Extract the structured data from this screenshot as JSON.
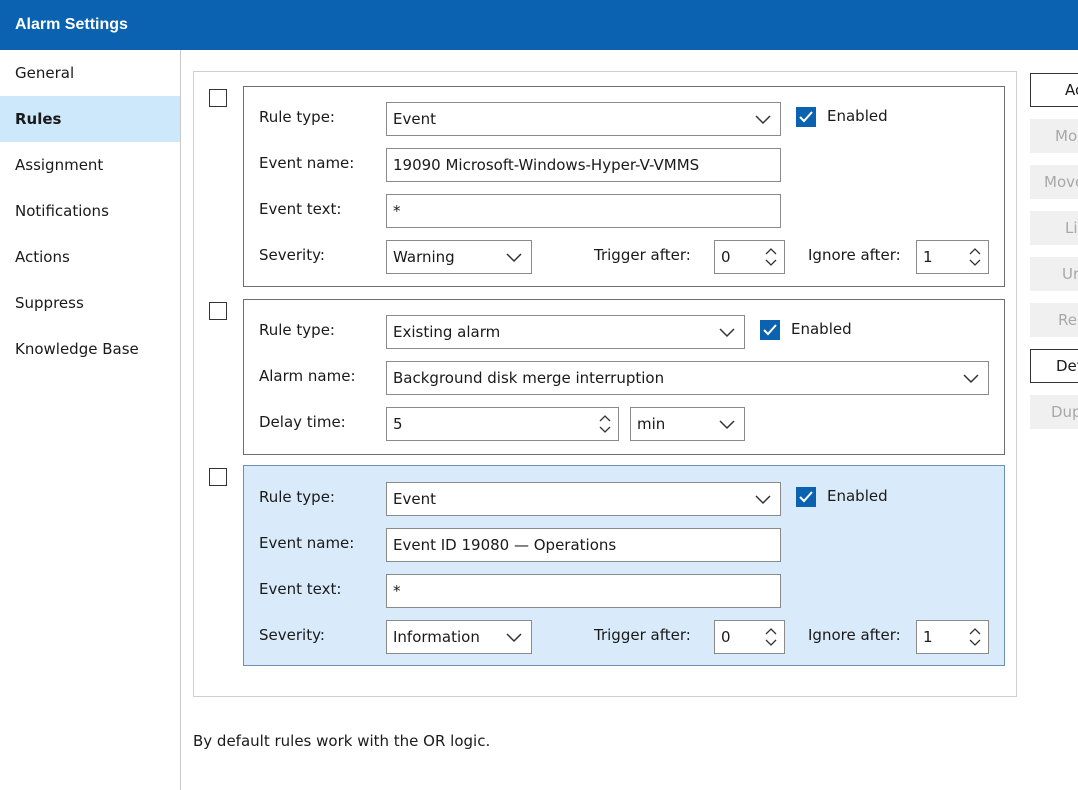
{
  "window": {
    "title": "Alarm Settings"
  },
  "sidebar": {
    "items": [
      {
        "label": "General"
      },
      {
        "label": "Rules",
        "active": true
      },
      {
        "label": "Assignment"
      },
      {
        "label": "Notifications"
      },
      {
        "label": "Actions"
      },
      {
        "label": "Suppress"
      },
      {
        "label": "Knowledge Base"
      }
    ]
  },
  "labels": {
    "rule_type": "Rule type:",
    "event_name": "Event name:",
    "event_text": "Event text:",
    "severity": "Severity:",
    "trigger_after": "Trigger after:",
    "ignore_after": "Ignore after:",
    "alarm_name": "Alarm name:",
    "delay_time": "Delay time:",
    "enabled": "Enabled"
  },
  "rules": [
    {
      "rule_type": "Event",
      "enabled": true,
      "event_name": "19090 Microsoft-Windows-Hyper-V-VMMS",
      "event_text": "*",
      "severity": "Warning",
      "trigger_after": "0",
      "ignore_after": "1"
    },
    {
      "rule_type": "Existing alarm",
      "enabled": true,
      "alarm_name": "Background disk merge interruption",
      "delay_time": "5",
      "delay_unit": "min"
    },
    {
      "rule_type": "Event",
      "enabled": true,
      "selected": true,
      "event_name": "Event ID 19080 — Operations",
      "event_text": "*",
      "severity": "Information",
      "trigger_after": "0",
      "ignore_after": "1"
    }
  ],
  "side_buttons": [
    {
      "label": "Ac",
      "enabled": true
    },
    {
      "label": "Mo",
      "enabled": false
    },
    {
      "label": "Move",
      "enabled": false
    },
    {
      "label": "Li",
      "enabled": false
    },
    {
      "label": "Ur",
      "enabled": false
    },
    {
      "label": "Re",
      "enabled": false
    },
    {
      "label": "Det",
      "enabled": true
    },
    {
      "label": "Dup",
      "enabled": false
    }
  ],
  "footer": {
    "note": "By default rules work with the OR logic."
  },
  "colors": {
    "title_bar": "#0a62b0",
    "selection": "#cde8fb",
    "selected_rule": "#d9ebfa",
    "checkbox": "#0a62b0"
  }
}
